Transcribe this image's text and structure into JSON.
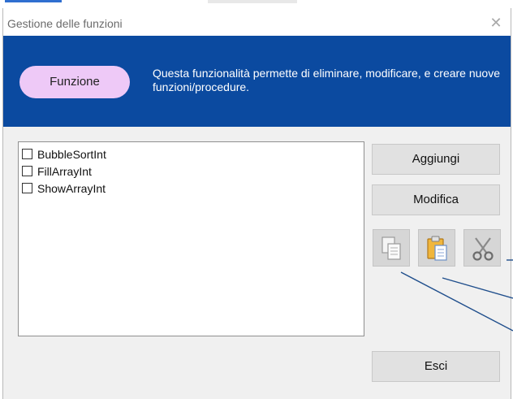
{
  "window": {
    "title": "Gestione delle funzioni",
    "close_symbol": "✕"
  },
  "banner": {
    "pill_label": "Funzione",
    "description": "Questa funzionalità permette di eliminare, modificare, e creare nuove funzioni/procedure.",
    "background_color": "#0b4aa0",
    "pill_color": "#eec9f7"
  },
  "functions": [
    {
      "name": "BubbleSortInt",
      "checked": false
    },
    {
      "name": "FillArrayInt",
      "checked": false
    },
    {
      "name": "ShowArrayInt",
      "checked": false
    }
  ],
  "buttons": {
    "add": "Aggiungi",
    "modify": "Modifica",
    "exit": "Esci"
  },
  "icons": {
    "copy": "copy-icon",
    "paste": "paste-icon",
    "cut": "scissors-icon"
  },
  "annotation_color": "#1f4e8c"
}
